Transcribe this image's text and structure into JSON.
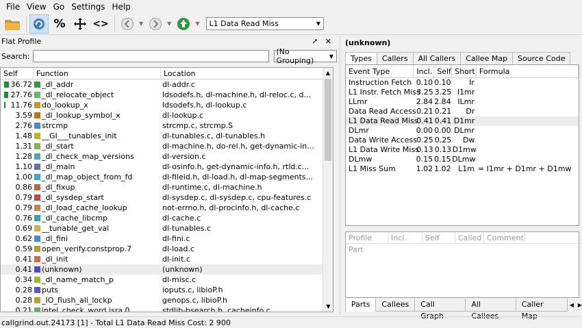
{
  "menu": [
    "File",
    "View",
    "Go",
    "Settings",
    "Help"
  ],
  "toolbar": {
    "event_select": "L1 Data Read Miss",
    "percent_label": "%",
    "code_label": "<>"
  },
  "left_panel": {
    "title": "Flat Profile",
    "dock_buttons": "⭧ ✕",
    "search_label": "Search:",
    "search_value": "",
    "grouping": "(No Grouping)",
    "columns": [
      "Self",
      "Function",
      "Location"
    ],
    "rows": [
      {
        "self": "36.72",
        "bar": 0.36,
        "color": "#2e9e3e",
        "func": "_dl_addr",
        "loc": "dl-addr.c"
      },
      {
        "self": "27.76",
        "bar": 0.28,
        "color": "#6bb56e",
        "func": "_dl_relocate_object",
        "loc": "ldsodefs.h, dl-machine.h, dl-reloc.c, d..."
      },
      {
        "self": "11.76",
        "bar": 0.12,
        "color": "#c9962a",
        "func": "do_lookup_x",
        "loc": "ldsodefs.h, dl-lookup.c"
      },
      {
        "self": "3.59",
        "bar": 0,
        "color": "#b0742a",
        "func": "_dl_lookup_symbol_x",
        "loc": "dl-lookup.c"
      },
      {
        "self": "2.76",
        "bar": 0,
        "color": "#4a8fc0",
        "func": "strcmp",
        "loc": "strcmp.c, strcmp.S"
      },
      {
        "self": "1.48",
        "bar": 0,
        "color": "#b9b03a",
        "func": "__GI___tunables_init",
        "loc": "dl-tunables.c, dl-tunables.h"
      },
      {
        "self": "1.31",
        "bar": 0,
        "color": "#8ab04a",
        "func": "_dl_start",
        "loc": "dl-machine.h, do-rel.h, get-dynamic-in..."
      },
      {
        "self": "1.28",
        "bar": 0,
        "color": "#5aa0a8",
        "func": "_dl_check_map_versions",
        "loc": "dl-version.c"
      },
      {
        "self": "1.10",
        "bar": 0,
        "color": "#6a6ab8",
        "func": "_dl_main",
        "loc": "dl-osinfo.h, get-dynamic-info.h, rtld.c..."
      },
      {
        "self": "1.00",
        "bar": 0,
        "color": "#4aa0c8",
        "func": "_dl_map_object_from_fd",
        "loc": "dl-fileid.h, dl-load.h, dl-map-segments..."
      },
      {
        "self": "0.86",
        "bar": 0,
        "color": "#b86a3a",
        "func": "_dl_fixup",
        "loc": "dl-runtime.c, dl-machine.h"
      },
      {
        "self": "0.79",
        "bar": 0,
        "color": "#b84a4a",
        "func": "_dl_sysdep_start",
        "loc": "dl-sysdep.c, dl-sysdep.c, cpu-features.c"
      },
      {
        "self": "0.79",
        "bar": 0,
        "color": "#c08a40",
        "func": "_dl_load_cache_lookup",
        "loc": "not-errno.h, dl-procinfo.h, dl-cache.c"
      },
      {
        "self": "0.76",
        "bar": 0,
        "color": "#3aa0a0",
        "func": "_dl_cache_libcmp",
        "loc": "dl-cache.c"
      },
      {
        "self": "0.69",
        "bar": 0,
        "color": "#c8b04a",
        "func": "__tunable_get_val",
        "loc": "dl-tunables.c"
      },
      {
        "self": "0.62",
        "bar": 0,
        "color": "#4a8ad0",
        "func": "_dl_fini",
        "loc": "dl-fini.c"
      },
      {
        "self": "0.59",
        "bar": 0,
        "color": "#b0a03a",
        "func": "open_verify.constprop.7",
        "loc": "dl-load.c"
      },
      {
        "self": "0.41",
        "bar": 0,
        "color": "#c0704a",
        "func": "_dl_init",
        "loc": "dl-init.c"
      },
      {
        "self": "0.41",
        "bar": 0,
        "color": "#4a4ad0",
        "func": "(unknown)",
        "loc": "(unknown)",
        "highlight": true
      },
      {
        "self": "0.34",
        "bar": 0,
        "color": "#a0b04a",
        "func": "_dl_name_match_p",
        "loc": "dl-misc.c"
      },
      {
        "self": "0.28",
        "bar": 0,
        "color": "#5a5ac8",
        "func": "puts",
        "loc": "ioputs.c, libioP.h"
      },
      {
        "self": "0.28",
        "bar": 0,
        "color": "#b0a040",
        "func": "_IO_flush_all_lockp",
        "loc": "genops.c, libioP.h"
      },
      {
        "self": "0.21",
        "bar": 0,
        "color": "#6ab06a",
        "func": "intel_check_word.isra.0",
        "loc": "stdlib-bsearch.h, cacheinfo.c"
      }
    ]
  },
  "right_panel": {
    "title": "(unknown)",
    "tabs": [
      "Types",
      "Callers",
      "All Callers",
      "Callee Map",
      "Source Code"
    ],
    "active_tab": 0,
    "columns": [
      "Event Type",
      "Incl.",
      "Self",
      "Short",
      "Formula"
    ],
    "events": [
      {
        "name": "Instruction Fetch",
        "incl": "0.10",
        "self": "0.10",
        "short": "Ir",
        "formula": ""
      },
      {
        "name": "L1 Instr. Fetch Miss",
        "incl": "3.25",
        "self": "3.25",
        "short": "I1mr",
        "formula": ""
      },
      {
        "name": "LLmr",
        "incl": "2.84",
        "self": "2.84",
        "short": "ILmr",
        "formula": ""
      },
      {
        "name": "Data Read Access",
        "incl": "0.21",
        "self": "0.21",
        "short": "Dr",
        "formula": ""
      },
      {
        "name": "L1 Data Read Miss",
        "incl": "0.41",
        "self": "0.41",
        "short": "D1mr",
        "formula": "",
        "highlight": true
      },
      {
        "name": "DLmr",
        "incl": "0.00",
        "self": "0.00",
        "short": "DLmr",
        "formula": ""
      },
      {
        "name": "Data Write Access",
        "incl": "0.25",
        "self": "0.25",
        "short": "Dw",
        "formula": ""
      },
      {
        "name": "L1 Data Write Miss",
        "incl": "0.13",
        "self": "0.13",
        "short": "D1mw",
        "formula": ""
      },
      {
        "name": "DLmw",
        "incl": "0.15",
        "self": "0.15",
        "short": "DLmw",
        "formula": ""
      },
      {
        "name": "L1 Miss Sum",
        "incl": "1.02",
        "self": "1.02",
        "short": "L1m",
        "formula": "=  I1mr + D1mr + D1mw"
      }
    ],
    "cost_columns": [
      "Profile Part",
      "Incl.",
      "Self",
      "Called",
      "Comment"
    ],
    "bottom_tabs": [
      "Parts",
      "Callees",
      "Call Graph",
      "All Callees",
      "Caller Map"
    ],
    "bottom_active": 0
  },
  "status": "callgrind.out.24173 [1] - Total L1 Data Read Miss Cost: 2 900"
}
